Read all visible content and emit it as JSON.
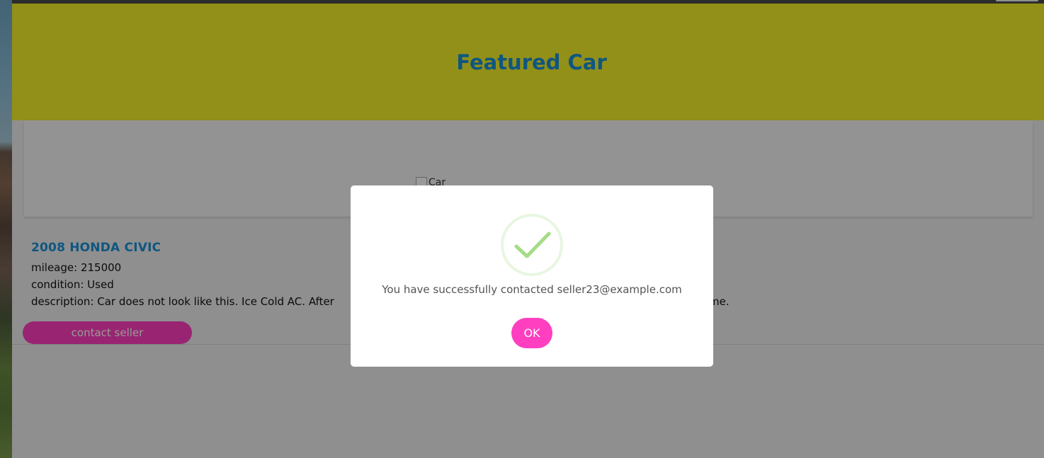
{
  "hero": {
    "title": "Featured Car"
  },
  "image": {
    "alt": "Car"
  },
  "listing": {
    "title": "2008 HONDA CIVIC",
    "mileage": "mileage: 215000",
    "condition": "condition: Used",
    "description": "description: Car does not look like this. Ice Cold AC. After",
    "description_tail": "me."
  },
  "contact_button": {
    "label": "contact seller"
  },
  "modal": {
    "message": "You have successfully contacted seller23@example.com",
    "ok_label": "OK",
    "icon": "check-icon"
  },
  "colors": {
    "hero_bg": "#f3f02a",
    "title_blue": "#1a8fd6",
    "accent_pink": "#ff3fbf",
    "check_green": "#a5dc86"
  }
}
